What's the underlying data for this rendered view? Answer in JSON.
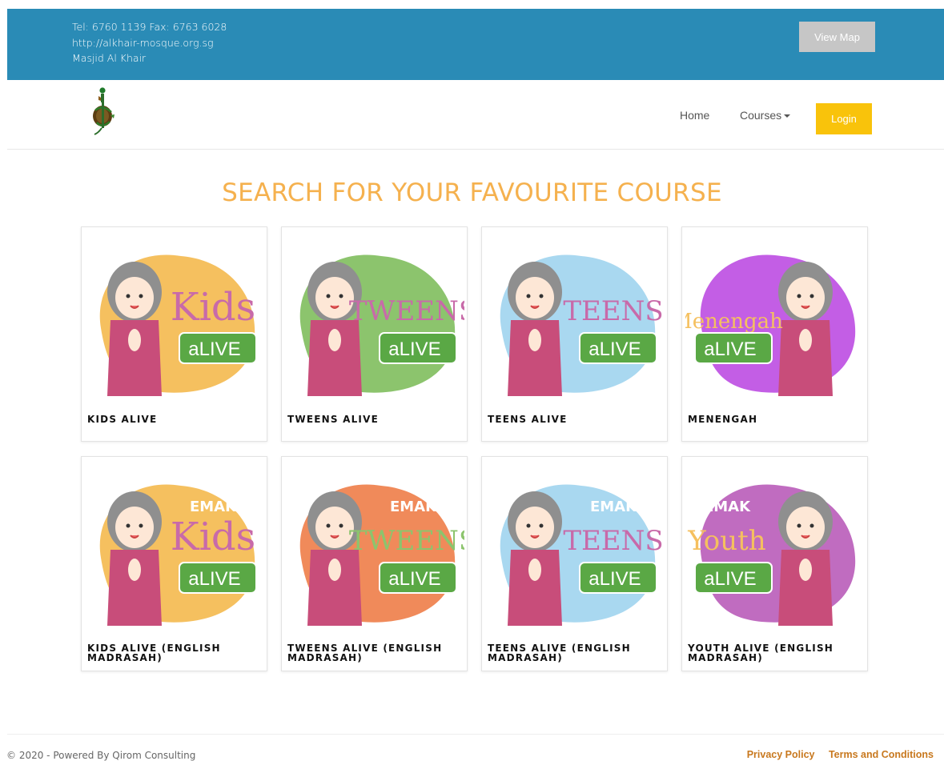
{
  "topbar": {
    "phone_fax": "Tel: 6760 1139 Fax: 6763 6028",
    "url": "http://alkhair-mosque.org.sg",
    "name": "Masjid Al Khair",
    "map_button": "View Map"
  },
  "nav": {
    "home": "Home",
    "courses": "Courses",
    "login": "Login"
  },
  "heading": "SEARCH FOR YOUR FAVOURITE COURSE",
  "courses": [
    {
      "title": "KIDS ALIVE",
      "blob": "#f5c05f",
      "word": "Kids",
      "word_color": "#c86aa9",
      "tag": ""
    },
    {
      "title": "TWEENS ALIVE",
      "blob": "#8cc46d",
      "word": "TWEENS",
      "word_color": "#c86aa9",
      "tag": ""
    },
    {
      "title": "TEENS ALIVE",
      "blob": "#a9d8f0",
      "word": "TEENS",
      "word_color": "#c86aa9",
      "tag": ""
    },
    {
      "title": "MENENGAH",
      "blob": "#c35ee5",
      "word": "Menengah",
      "word_color": "#f5c05f",
      "tag": ""
    },
    {
      "title": "KIDS ALIVE (ENGLISH MADRASAH)",
      "blob": "#f5c05f",
      "word": "Kids",
      "word_color": "#c86aa9",
      "tag": "EMAK"
    },
    {
      "title": "TWEENS ALIVE (ENGLISH MADRASAH)",
      "blob": "#f08a5a",
      "word": "TWEENS",
      "word_color": "#8cc46d",
      "tag": "EMAK"
    },
    {
      "title": "TEENS ALIVE (ENGLISH MADRASAH)",
      "blob": "#a9d8f0",
      "word": "TEENS",
      "word_color": "#c86aa9",
      "tag": "EMAK"
    },
    {
      "title": "YOUTH ALIVE (ENGLISH MADRASAH)",
      "blob": "#c06cc0",
      "word": "Youth",
      "word_color": "#f5c05f",
      "tag": "EMAK"
    }
  ],
  "badge_text": "aLIVE",
  "footer": {
    "copyright": "© 2020 - Powered By Qirom Consulting",
    "privacy": "Privacy Policy",
    "terms": "Terms and Conditions"
  },
  "colors": {
    "topbar": "#2a8bb6",
    "heading": "#f5b14e",
    "login": "#f9c30b",
    "footer_links": "#c8781e"
  }
}
